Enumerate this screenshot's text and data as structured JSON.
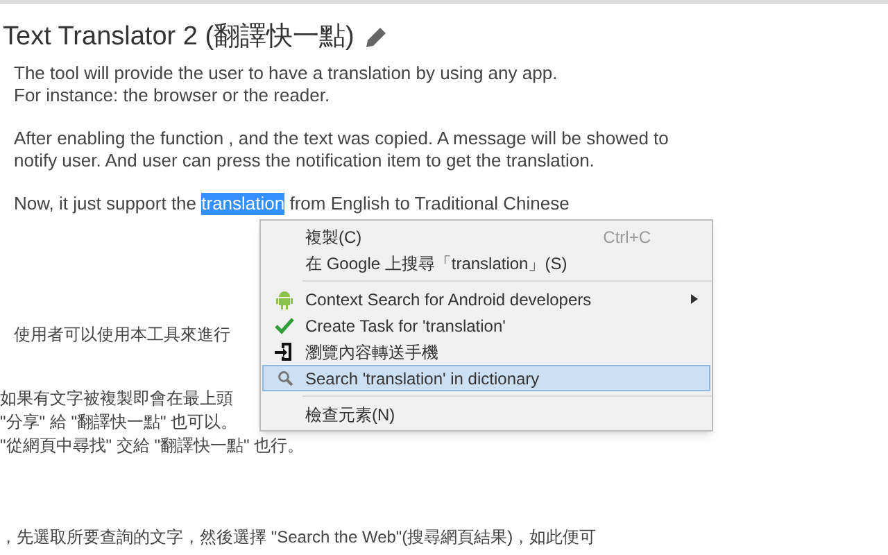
{
  "page": {
    "title": "Text Translator 2 (翻譯快一點)",
    "intro": [
      "The tool will provide the user to have a translation by using any app.",
      "For instance: the browser or the reader."
    ],
    "notice": [
      "After enabling the function , and the text was copied. A message will be showed to",
      "notify user. And user can press the notification item to get the translation."
    ],
    "support": {
      "before": "Now, it just support the ",
      "selected_text": "translation",
      "after": " from English to Traditional Chinese"
    },
    "usage": "使用者可以使用本工具來進行",
    "notes": [
      "如果有文字被複製即會在最上頭",
      "\"分享\" 給 \"翻譯快一點\" 也可以。",
      "\"從網頁中尋找\" 交給 \"翻譯快一點\" 也行。"
    ],
    "footer": "，先選取所要查詢的文字，然後選擇 \"Search the Web\"(搜尋網頁結果)，如此便可"
  },
  "context_menu": {
    "items": [
      {
        "kind": "item",
        "label": "複製(C)",
        "shortcut": "Ctrl+C",
        "selected": false
      },
      {
        "kind": "item",
        "label": "在 Google 上搜尋「translation」(S)",
        "selected": false
      },
      {
        "kind": "separator"
      },
      {
        "kind": "android",
        "label": "Context Search for Android developers",
        "submenu": true,
        "selected": false
      },
      {
        "kind": "task",
        "label": "Create Task for 'translation'",
        "selected": false
      },
      {
        "kind": "send",
        "label": "瀏覽內容轉送手機",
        "selected": false
      },
      {
        "kind": "search",
        "label": "Search 'translation' in dictionary",
        "selected": true
      },
      {
        "kind": "separator"
      },
      {
        "kind": "item",
        "label": "檢查元素(N)",
        "selected": false
      }
    ]
  }
}
